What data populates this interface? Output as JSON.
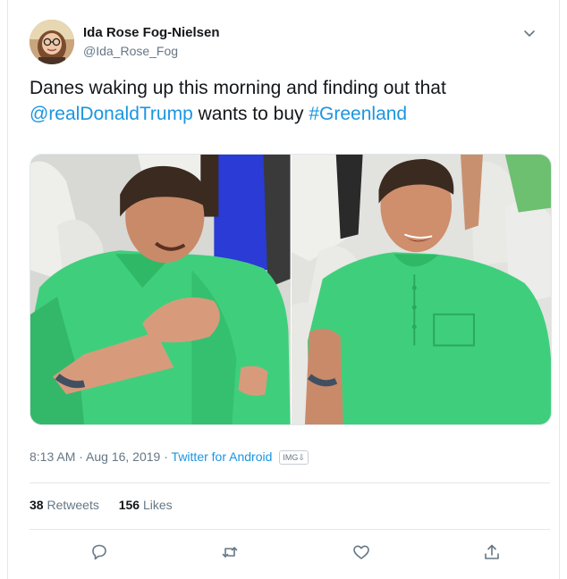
{
  "tweet": {
    "author": {
      "display_name": "Ida Rose Fog-Nielsen",
      "handle": "@Ida_Rose_Fog"
    },
    "text": {
      "part1": "Danes waking up this morning and finding out that ",
      "mention": "@realDonaldTrump",
      "part2": " wants to buy ",
      "hashtag": "#Greenland"
    },
    "meta": {
      "timestamp": "8:13 AM · Aug 16, 2019",
      "separator": " · ",
      "source": "Twitter for Android",
      "badge": "IMG⇩"
    },
    "stats": {
      "retweets_count": "38",
      "retweets_label": "Retweets",
      "likes_count": "156",
      "likes_label": "Likes"
    },
    "actions": [
      "reply-icon",
      "retweet-icon",
      "like-icon",
      "share-icon"
    ]
  },
  "colors": {
    "link": "#1b95e0",
    "text": "#14171a",
    "secondary": "#657786",
    "border": "#e1e8ed",
    "shirt_green": "#3fcf7c"
  }
}
